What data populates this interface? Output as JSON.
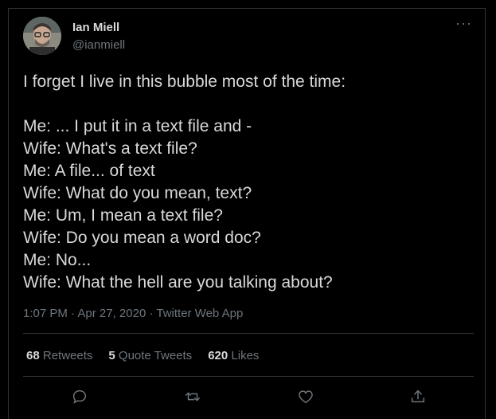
{
  "author": {
    "name": "Ian Miell",
    "handle": "@ianmiell"
  },
  "tweet": {
    "lines": [
      "I forget I live in this bubble most of the time:",
      "",
      "Me: ... I put it in a text file and -",
      "Wife: What's a text file?",
      "Me: A file... of text",
      "Wife: What do you mean, text?",
      "Me: Um, I mean a text file?",
      "Wife: Do you mean a word doc?",
      "Me: No...",
      "Wife: What the hell are you talking about?"
    ],
    "time": "1:07 PM",
    "date": "Apr 27, 2020",
    "source": "Twitter Web App",
    "separator": " · "
  },
  "stats": {
    "retweets_count": "68",
    "retweets_label": "Retweets",
    "quote_count": "5",
    "quote_label": "Quote Tweets",
    "likes_count": "620",
    "likes_label": "Likes"
  },
  "more_glyph": "···",
  "icons": [
    "reply-icon",
    "retweet-icon",
    "like-icon",
    "share-icon"
  ],
  "colors": {
    "background": "#000000",
    "text": "#d9d9d9",
    "secondary": "#6e767d",
    "border": "#2f3336"
  }
}
